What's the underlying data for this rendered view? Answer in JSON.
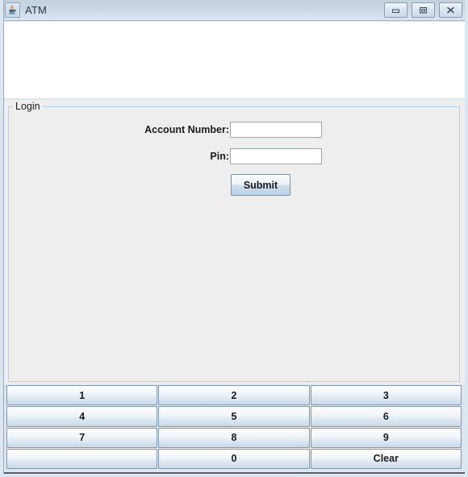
{
  "window": {
    "title": "ATM",
    "icon": "java-coffee-cup-icon",
    "controls": {
      "minimize_label": "Minimize",
      "maximize_label": "Maximize",
      "close_label": "Close"
    }
  },
  "display": {
    "text": ""
  },
  "login": {
    "legend": "Login",
    "account_label": "Account Number:",
    "account_value": "",
    "account_placeholder": "",
    "pin_label": "Pin:",
    "pin_value": "",
    "pin_placeholder": "",
    "submit_label": "Submit"
  },
  "keypad": {
    "keys": [
      {
        "label": "1"
      },
      {
        "label": "2"
      },
      {
        "label": "3"
      },
      {
        "label": "4"
      },
      {
        "label": "5"
      },
      {
        "label": "6"
      },
      {
        "label": "7"
      },
      {
        "label": "8"
      },
      {
        "label": "9"
      },
      {
        "label": ""
      },
      {
        "label": "0"
      },
      {
        "label": "Clear"
      }
    ]
  },
  "colors": {
    "window_frame": "#dce6f1",
    "titlebar_top": "#c3d0de",
    "panel_background": "#eeeeee",
    "display_background": "#ffffff",
    "border_accent": "#bccfe0",
    "button_gradient_bottom": "#c9d9e9"
  }
}
